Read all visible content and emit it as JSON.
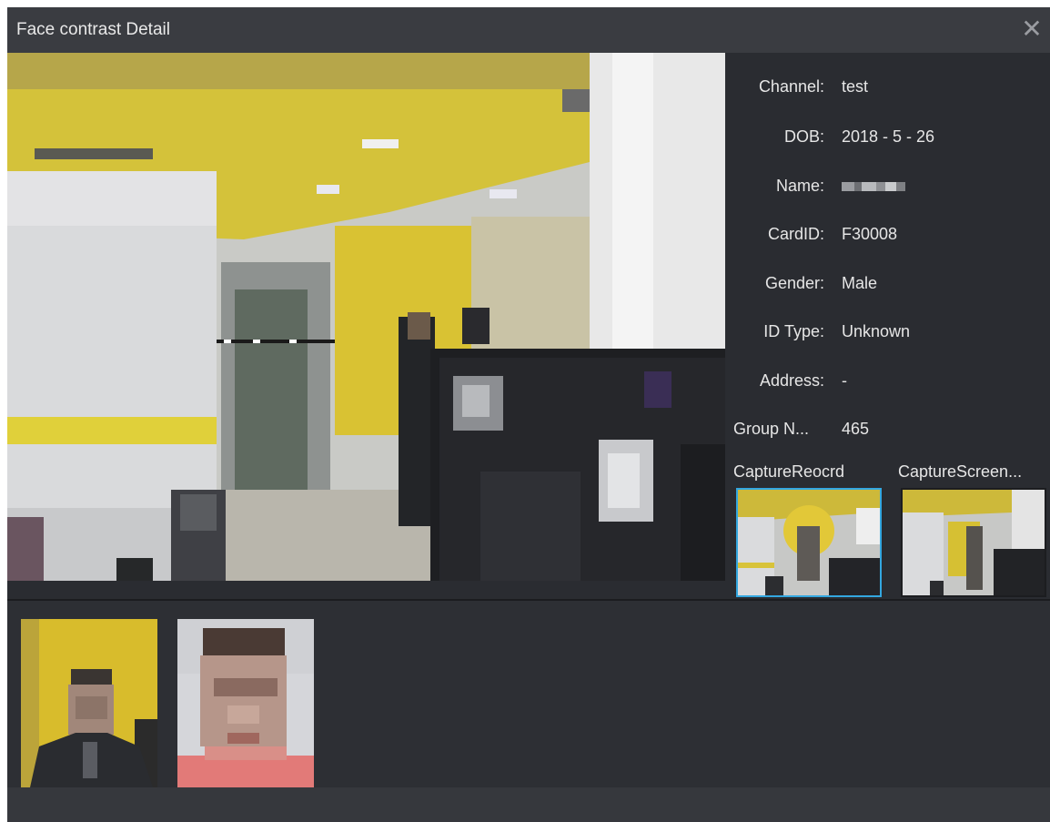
{
  "window": {
    "title": "Face contrast Detail",
    "close_glyph": "✕",
    "close_icon": "close-icon"
  },
  "info": {
    "channel": {
      "label": "Channel:",
      "value": "test"
    },
    "dob": {
      "label": "DOB:",
      "value": "2018 - 5 - 26"
    },
    "name": {
      "label": "Name:",
      "value": ""
    },
    "card_id": {
      "label": "CardID:",
      "value": "F30008"
    },
    "gender": {
      "label": "Gender:",
      "value": "Male"
    },
    "id_type": {
      "label": "ID Type:",
      "value": "Unknown"
    },
    "address": {
      "label": "Address:",
      "value": "-"
    },
    "group": {
      "label": "Group N...",
      "value": "465"
    }
  },
  "captures": {
    "record_label": "CaptureReocrd",
    "screen_label": "CaptureScreen..."
  },
  "colors": {
    "dialog_bg": "#2a2c31",
    "titlebar_bg": "#3a3c41",
    "selected_border": "#33a7e0",
    "accent_yellow": "#d8bc2c"
  }
}
